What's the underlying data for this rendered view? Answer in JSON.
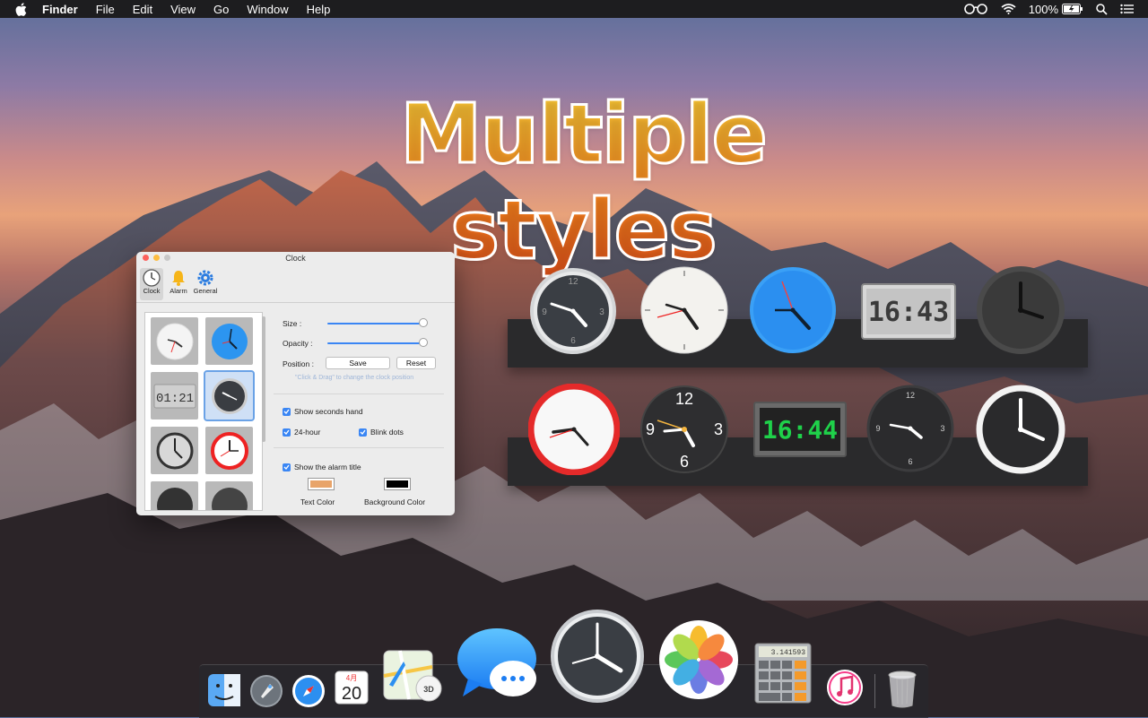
{
  "menubar": {
    "app_name": "Finder",
    "items": [
      "File",
      "Edit",
      "View",
      "Go",
      "Window",
      "Help"
    ],
    "battery": "100%",
    "icons": [
      "glasses-icon",
      "wifi-icon",
      "battery-icon",
      "search-icon",
      "list-icon"
    ]
  },
  "headline": "Multiple styles",
  "window": {
    "title": "Clock",
    "tabs": [
      {
        "label": "Clock",
        "icon": "clock-icon"
      },
      {
        "label": "Alarm",
        "icon": "bell-icon"
      },
      {
        "label": "General",
        "icon": "gear-icon"
      }
    ],
    "size_label": "Size :",
    "size_value": 1.0,
    "opacity_label": "Opacity :",
    "opacity_value": 1.0,
    "position_label": "Position :",
    "save_label": "Save",
    "reset_label": "Reset",
    "position_hint": "\"Click & Drag\" to change the clock position",
    "show_seconds_label": "Show seconds hand",
    "h24_label": "24-hour",
    "blink_label": "Blink dots",
    "show_alarm_title_label": "Show the alarm title",
    "text_color_label": "Text Color",
    "bg_color_label": "Background Color",
    "text_color": "#e8a46a",
    "bg_color": "#000000",
    "digital_preview": "01:21"
  },
  "shelf_digital": {
    "row1": "16:43",
    "row2": "16:44"
  },
  "dock": {
    "calendar_month": "4月",
    "calendar_day": "20",
    "calculator_display": "3.141593",
    "maps_badge": "3D",
    "icons": [
      "finder-icon",
      "launchpad-icon",
      "safari-icon",
      "calendar-icon",
      "maps-icon",
      "messages-icon",
      "clock-icon",
      "photos-icon",
      "calculator-icon",
      "itunes-icon",
      "trash-icon"
    ]
  },
  "colors": {
    "accent_blue": "#3a86f4",
    "headline_orange": "#ff8a1e",
    "shelf": "#2a2a2c"
  }
}
